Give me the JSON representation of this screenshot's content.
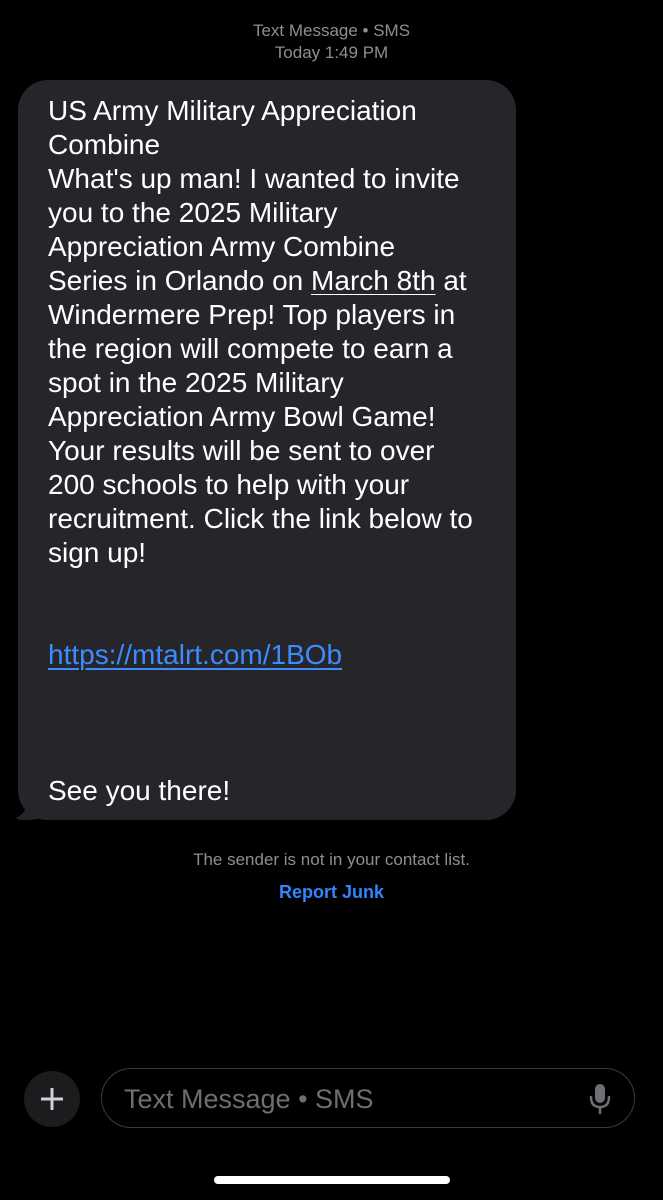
{
  "header": {
    "service": "Text Message • SMS",
    "time": "Today 1:49 PM"
  },
  "message": {
    "lines": [
      "US Army Military Appreciation",
      "Combine",
      "What's up man! I wanted to invite",
      "you to the 2025 Military",
      "Appreciation Army Combine"
    ],
    "orlando_prefix": "Series in Orlando on ",
    "date_link": "March 8th",
    "orlando_suffix": " at",
    "lines_after": [
      "Windermere Prep! Top players in",
      "the region will compete to earn a",
      "spot in the 2025 Military",
      "Appreciation Army Bowl Game!",
      "Your results will be sent to over",
      "200 schools to help with your",
      "recruitment. Click the link below to",
      "sign up!"
    ],
    "url": "https://mtalrt.com/1BOb",
    "closing": "See you there!"
  },
  "notice": {
    "sender_note": "The sender is not in your contact list.",
    "report_junk": "Report Junk"
  },
  "input": {
    "placeholder": "Text Message • SMS"
  },
  "colors": {
    "bubble": "#26252a",
    "link": "#3a8cff",
    "secondary_text": "#8e8e93"
  }
}
